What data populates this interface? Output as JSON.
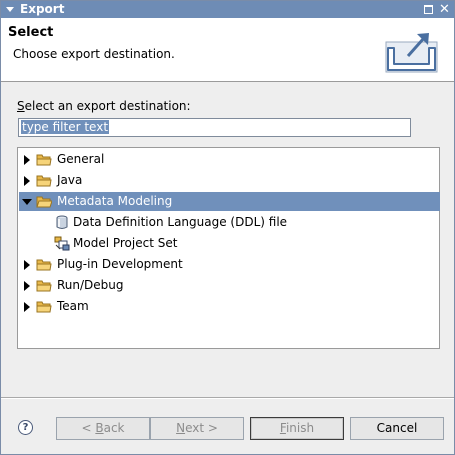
{
  "window": {
    "title": "Export"
  },
  "banner": {
    "heading": "Select",
    "description": "Choose export destination."
  },
  "destination": {
    "label_mnemonic": "S",
    "label_rest": "elect an export destination:",
    "filter_value": "type filter text"
  },
  "tree": {
    "items": [
      {
        "label": "General",
        "expanded": false,
        "selected": false,
        "icon": "folder-icon"
      },
      {
        "label": "Java",
        "expanded": false,
        "selected": false,
        "icon": "folder-icon"
      },
      {
        "label": "Metadata Modeling",
        "expanded": true,
        "selected": true,
        "icon": "folder-open-icon"
      },
      {
        "label": "Data Definition Language (DDL) file",
        "child": true,
        "icon": "database-icon"
      },
      {
        "label": "Model Project Set",
        "child": true,
        "icon": "project-set-icon"
      },
      {
        "label": "Plug-in Development",
        "expanded": false,
        "selected": false,
        "icon": "folder-icon"
      },
      {
        "label": "Run/Debug",
        "expanded": false,
        "selected": false,
        "icon": "folder-icon"
      },
      {
        "label": "Team",
        "expanded": false,
        "selected": false,
        "icon": "folder-icon"
      }
    ]
  },
  "buttons": {
    "help": "?",
    "back_prefix": "< ",
    "back_mnemonic": "B",
    "back_rest": "ack",
    "next_mnemonic": "N",
    "next_rest": "ext >",
    "finish_mnemonic": "F",
    "finish_rest": "inish",
    "cancel": "Cancel"
  },
  "colors": {
    "selection": "#7090bb",
    "titlebar": "#6e8cb5"
  }
}
